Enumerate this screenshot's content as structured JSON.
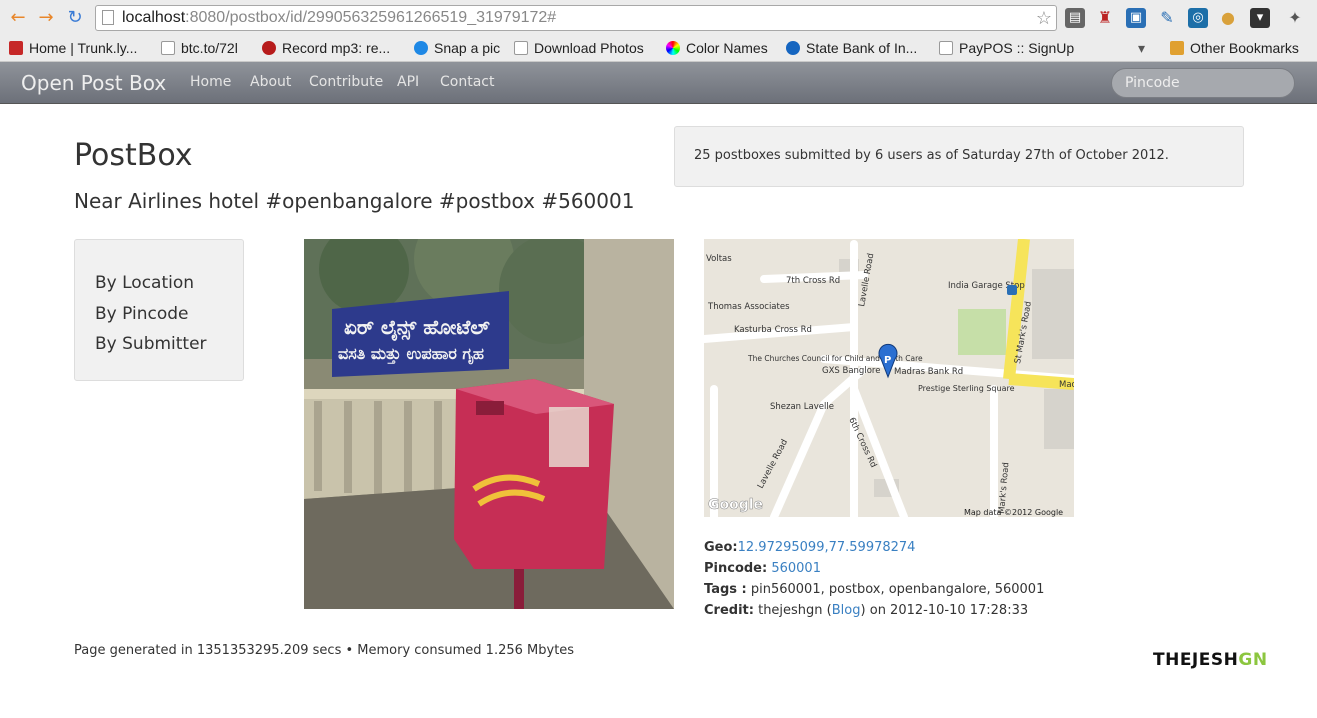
{
  "browser": {
    "url_host": "localhost",
    "url_rest": ":8080/postbox/id/299056325961266519_31979172#",
    "bookmarks": [
      "Home | Trunk.ly...",
      "btc.to/72l",
      "Record mp3: re...",
      "Snap a pic",
      "Download Photos",
      "Color Names",
      "State Bank of In...",
      "PayPOS :: SignUp"
    ],
    "other_bookmarks": "Other Bookmarks"
  },
  "navbar": {
    "brand": "Open Post Box",
    "links": [
      "Home",
      "About",
      "Contribute",
      "API",
      "Contact"
    ],
    "search_placeholder": "Pincode"
  },
  "page": {
    "title": "PostBox",
    "subtitle": "Near Airlines hotel #openbangalore #postbox #560001",
    "stats": "25 postboxes submitted by 6 users as of Saturday 27th of October 2012."
  },
  "sidebar": {
    "items": [
      "By Location",
      "By Pincode",
      "By Submitter"
    ]
  },
  "photo": {
    "sign_text": "ಏರ್ ಲೈನ್ಸ್ ಹೋಟೆಲ್",
    "sign_text2": "ವಸತಿ ಮತ್ತು ಉಪಹಾರ ಗೃಹ"
  },
  "map": {
    "labels": {
      "voltas": "Voltas",
      "seventh_cross": "7th Cross Rd",
      "lavelle_road": "Lavelle Road",
      "india_garage": "India Garage Stop",
      "thomas": "Thomas Associates",
      "kasturba": "Kasturba Cross Rd",
      "st_marks": "St Mark's Road",
      "churches": "The Churches Council for Child and Youth Care",
      "gxs": "GXS Banglore",
      "madras_bank": "Madras Bank Rd",
      "prestige": "Prestige Sterling Square",
      "shezan": "Shezan Lavelle",
      "sixth_cross": "6th Cross Rd",
      "lavelle_road2": "Lavelle Road",
      "marks_road2": "Mark's Road",
      "mac": "Mac"
    },
    "copyright": "Map data ©2012 Google",
    "google": "Google"
  },
  "details": {
    "geo_label": "Geo:",
    "geo_value": "12.97295099,77.59978274",
    "pincode_label": "Pincode:",
    "pincode_value": "560001",
    "tags_label": "Tags :",
    "tags_value": "pin560001, postbox, openbangalore, 560001",
    "credit_label": "Credit:",
    "credit_user": "thejeshgn",
    "credit_blog": "Blog",
    "credit_date": "on 2012-10-10 17:28:33"
  },
  "footer": {
    "text": "Page generated in 1351353295.209 secs • Memory consumed 1.256 Mbytes",
    "logo_main": "THEJESH",
    "logo_gn": "GN"
  }
}
